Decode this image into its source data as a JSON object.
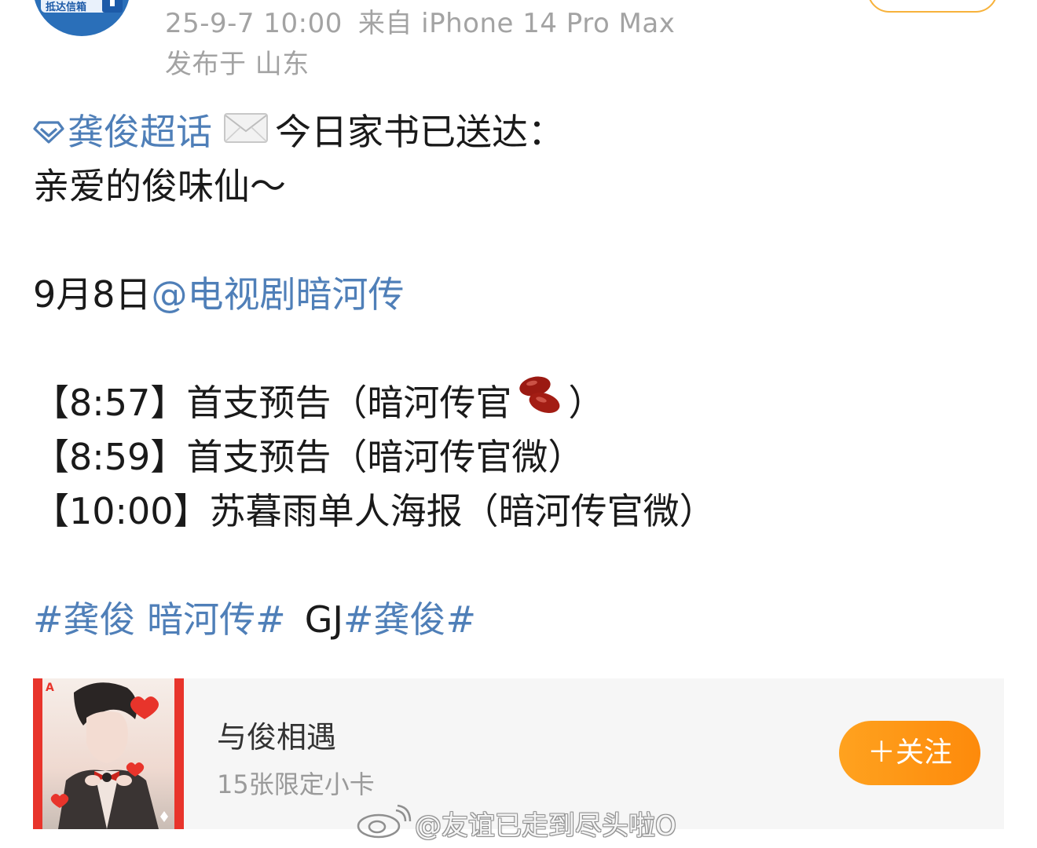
{
  "header": {
    "avatar_text": "抵达信箱",
    "timestamp": "25-9-7 10:00",
    "source": "来自 iPhone 14 Pro Max",
    "location": "发布于 山东"
  },
  "post": {
    "supertopic_link": "龚俊超话",
    "intro_text": "今日家书已送达：",
    "greeting": "亲爱的俊味仙～",
    "date_text": "9月8日",
    "mention": "@电视剧暗河传",
    "schedule": [
      {
        "time": "【8:57】",
        "text": "首支预告（暗河传官",
        "suffix": "）"
      },
      {
        "time": "【8:59】",
        "text": "首支预告（暗河传官微）",
        "suffix": ""
      },
      {
        "time": "【10:00】",
        "text": "苏暮雨单人海报（暗河传官微）",
        "suffix": ""
      }
    ],
    "hashtag_1": "#龚俊 暗河传#",
    "hashtag_prefix": "GJ",
    "hashtag_2": "#龚俊#"
  },
  "card": {
    "title": "与俊相遇",
    "subtitle": "15张限定小卡",
    "follow_button": "＋关注"
  },
  "watermark": {
    "text": "@友谊已走到尽头啦O"
  },
  "colors": {
    "link": "#4f7fb8",
    "follow_button": "#fd8a0b",
    "meta_text": "#a3a3a3"
  },
  "icons": {
    "supertopic": "diamond-icon",
    "envelope": "envelope-icon",
    "bean": "red-bean-icon",
    "weibo": "weibo-logo-icon"
  }
}
